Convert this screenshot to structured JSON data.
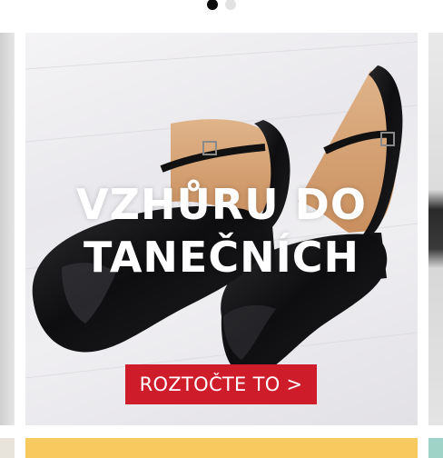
{
  "carousel": {
    "dots": [
      {
        "state": "active"
      },
      {
        "state": "inactive"
      }
    ]
  },
  "banner": {
    "headline_line1": "VZHŮRU DO",
    "headline_line2": "TANEČNÍCH",
    "cta_label": "ROZTOČTE TO >",
    "image_subject": "black-satin-dance-shoes",
    "cta_color": "#cf1c2a"
  },
  "next_banner": {
    "color": "#f7c95e"
  }
}
